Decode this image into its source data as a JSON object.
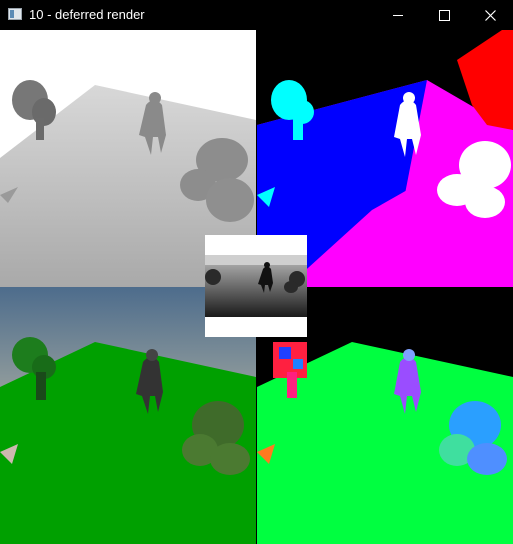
{
  "window": {
    "title": "10 - deferred render",
    "icon": "app-window-icon",
    "controls": [
      "minimize-icon",
      "maximize-icon",
      "close-icon"
    ]
  },
  "viewport": {
    "quadrants": [
      "depth-buffer",
      "flat-color-buffer",
      "albedo-buffer",
      "normal-buffer"
    ],
    "inset": "shadow-depth-map",
    "colors": {
      "ground_green": "#00a000",
      "normal_green": "#00ff40",
      "sky_blue": "#0000ff",
      "magenta": "#ff00ff",
      "red": "#ff0000",
      "cyan": "#00ffff"
    }
  }
}
